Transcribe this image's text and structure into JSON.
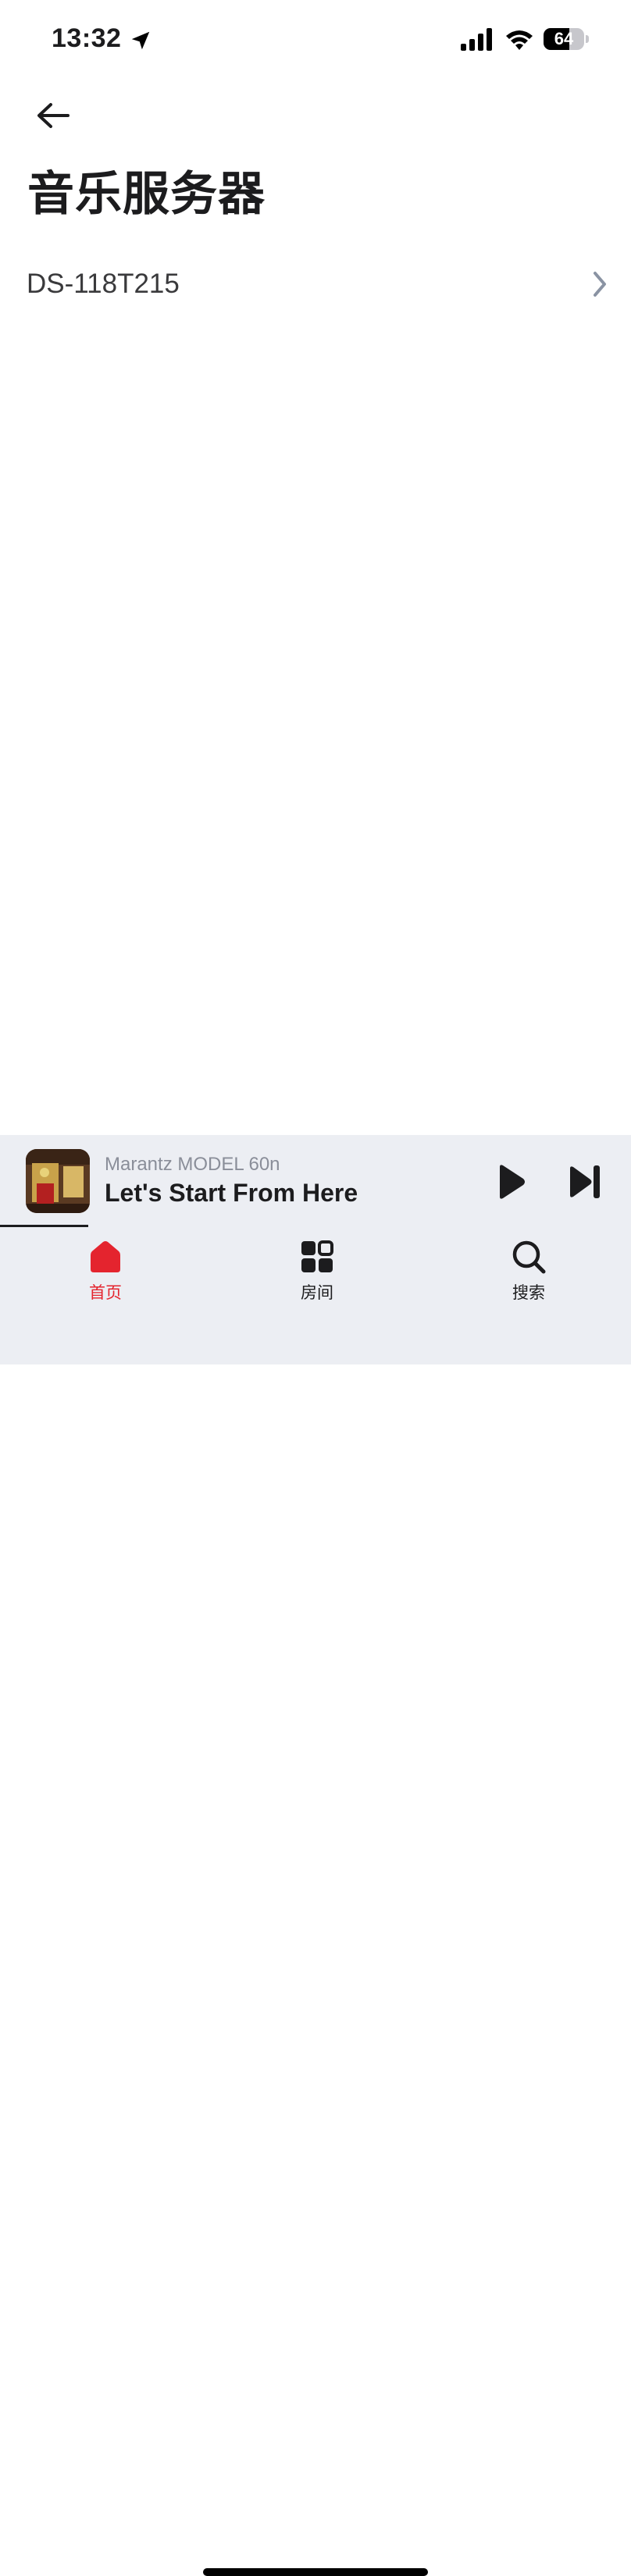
{
  "status_bar": {
    "time": "13:32",
    "battery_level": "64",
    "battery_fraction": 0.64
  },
  "header": {
    "title": "音乐服务器",
    "back_icon": "arrow-left-icon"
  },
  "servers": [
    {
      "name": "DS-118T215",
      "chevron_icon": "chevron-right-icon"
    }
  ],
  "mini_player": {
    "device": "Marantz MODEL 60n",
    "track": "Let's Start From Here",
    "progress_fraction": 0.14
  },
  "tabs": [
    {
      "label": "首页",
      "icon": "home-icon",
      "active": true
    },
    {
      "label": "房间",
      "icon": "rooms-grid-icon",
      "active": false
    },
    {
      "label": "搜索",
      "icon": "search-icon",
      "active": false
    }
  ],
  "colors": {
    "accent": "#e4242e",
    "panel_bg": "#eceef3",
    "text": "#1c1c1e",
    "muted": "#8a8e99"
  }
}
